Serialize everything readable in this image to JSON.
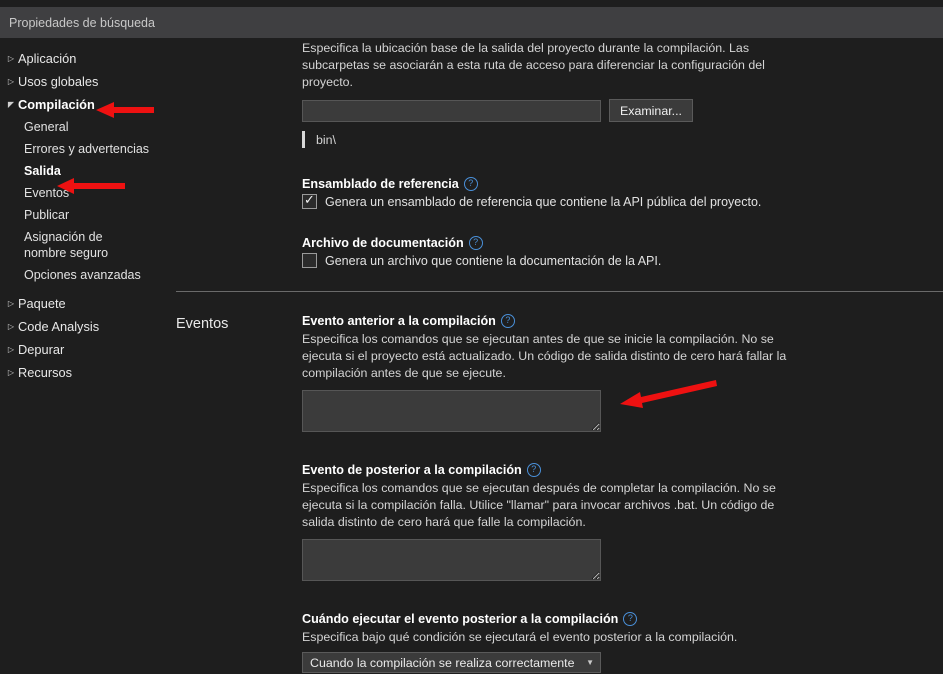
{
  "search": {
    "placeholder": "Propiedades de búsqueda",
    "value": ""
  },
  "sidebar": {
    "items": [
      {
        "label": "Aplicación",
        "icon": "chevron-right-icon",
        "expanded": false
      },
      {
        "label": "Usos globales",
        "icon": "chevron-right-icon",
        "expanded": false
      },
      {
        "label": "Compilación",
        "icon": "chevron-down-icon",
        "expanded": true,
        "children": [
          {
            "label": "General",
            "selected": false
          },
          {
            "label": "Errores y advertencias",
            "selected": false
          },
          {
            "label": "Salida",
            "selected": true
          },
          {
            "label": "Eventos",
            "selected": false
          },
          {
            "label": "Publicar",
            "selected": false
          },
          {
            "label": "Asignación de nombre seguro",
            "selected": false
          },
          {
            "label": "Opciones avanzadas",
            "selected": false
          }
        ]
      },
      {
        "label": "Paquete",
        "icon": "chevron-right-icon",
        "expanded": false
      },
      {
        "label": "Code Analysis",
        "icon": "chevron-right-icon",
        "expanded": false
      },
      {
        "label": "Depurar",
        "icon": "chevron-right-icon",
        "expanded": false
      },
      {
        "label": "Recursos",
        "icon": "chevron-right-icon",
        "expanded": false
      }
    ]
  },
  "output_section": {
    "base_output_desc": "Especifica la ubicación base de la salida del proyecto durante la compilación. Las subcarpetas se asociarán a esta ruta de acceso para diferenciar la configuración del proyecto.",
    "base_output_value": "",
    "browse_label": "Examinar...",
    "hint": "bin\\",
    "reference_assembly": {
      "title": "Ensamblado de referencia",
      "help": "?",
      "checked": true,
      "checkbox_label": "Genera un ensamblado de referencia que contiene la API pública del proyecto."
    },
    "documentation_file": {
      "title": "Archivo de documentación",
      "help": "?",
      "checked": false,
      "checkbox_label": "Genera un archivo que contiene la documentación de la API."
    }
  },
  "events_section": {
    "title": "Eventos",
    "pre_build": {
      "title": "Evento anterior a la compilación",
      "help": "?",
      "desc": "Especifica los comandos que se ejecutan antes de que se inicie la compilación. No se ejecuta si el proyecto está actualizado. Un código de salida distinto de cero hará fallar la compilación antes de que se ejecute.",
      "value": ""
    },
    "post_build": {
      "title": "Evento de posterior a la compilación",
      "help": "?",
      "desc": "Especifica los comandos que se ejecutan después de completar la compilación. No se ejecuta si la compilación falla. Utilice \"llamar\" para invocar archivos .bat. Un código de salida distinto de cero hará que falle la compilación.",
      "value": ""
    },
    "run_post_build": {
      "title": "Cuándo ejecutar el evento posterior a la compilación",
      "help": "?",
      "desc": "Especifica bajo qué condición se ejecutará el evento posterior a la compilación.",
      "selected": "Cuando la compilación se realiza correctamente",
      "caret": "▼"
    }
  },
  "annotations": {
    "color": "#ee1111",
    "arrows": [
      {
        "name": "arrow-compilacion"
      },
      {
        "name": "arrow-salida"
      },
      {
        "name": "arrow-pre-build-textbox"
      }
    ]
  }
}
